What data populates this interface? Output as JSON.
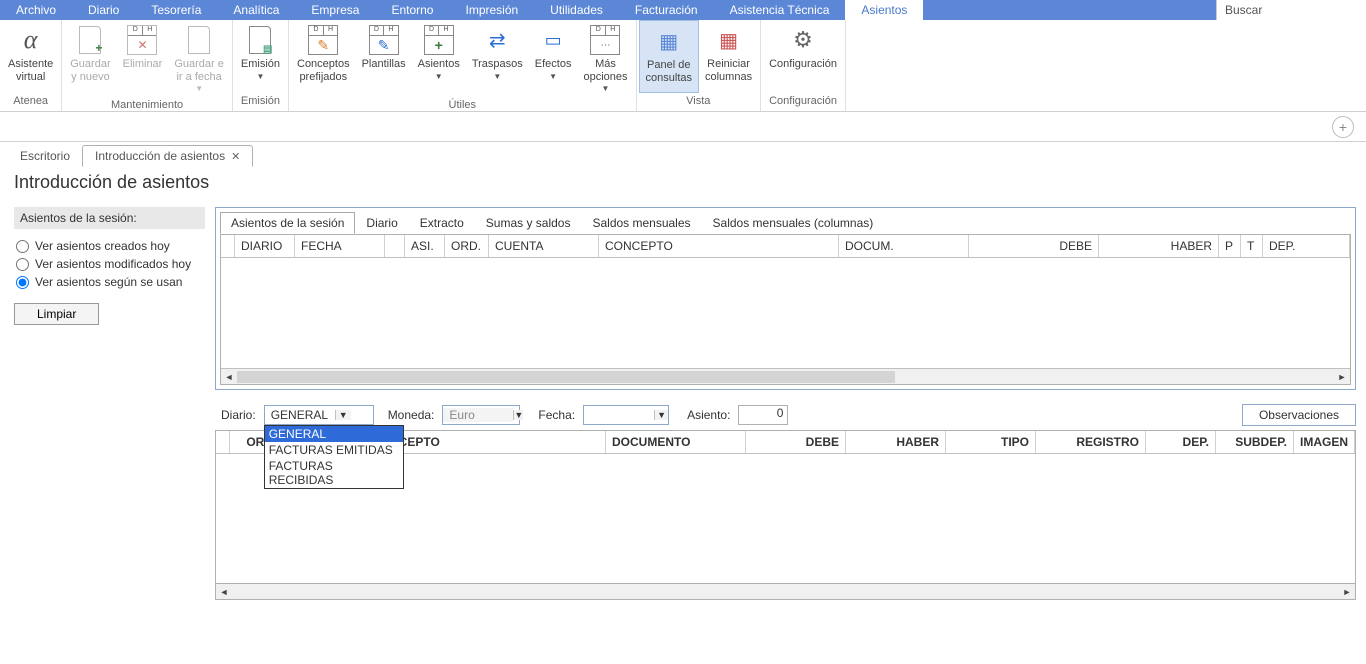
{
  "menu": [
    "Archivo",
    "Diario",
    "Tesorería",
    "Analítica",
    "Empresa",
    "Entorno",
    "Impresión",
    "Utilidades",
    "Facturación",
    "Asistencia Técnica",
    "Asientos"
  ],
  "menu_active_index": 10,
  "search_placeholder": "Buscar",
  "ribbon_groups": [
    {
      "label": "Atenea",
      "buttons": [
        {
          "label": "Asistente\nvirtual",
          "icon": "alpha"
        }
      ]
    },
    {
      "label": "Mantenimiento",
      "buttons": [
        {
          "label": "Guardar\ny nuevo",
          "icon": "doc-plus",
          "disabled": true
        },
        {
          "label": "Eliminar",
          "icon": "dh-x",
          "disabled": true
        },
        {
          "label": "Guardar e\nir a fecha",
          "icon": "doc",
          "disabled": true,
          "drop": true
        }
      ]
    },
    {
      "label": "Emisión",
      "buttons": [
        {
          "label": "Emisión",
          "icon": "doc-print",
          "drop": true
        }
      ]
    },
    {
      "label": "Útiles",
      "buttons": [
        {
          "label": "Conceptos\nprefijados",
          "icon": "dh-pen"
        },
        {
          "label": "Plantillas",
          "icon": "dh-pen"
        },
        {
          "label": "Asientos",
          "icon": "dh-plus",
          "drop": true
        },
        {
          "label": "Traspasos",
          "icon": "arrows",
          "drop": true
        },
        {
          "label": "Efectos",
          "icon": "cards",
          "drop": true
        },
        {
          "label": "Más\nopciones",
          "icon": "dh-dots",
          "drop": true
        }
      ]
    },
    {
      "label": "Vista",
      "buttons": [
        {
          "label": "Panel de\nconsultas",
          "icon": "panel",
          "active": true
        },
        {
          "label": "Reiniciar\ncolumnas",
          "icon": "grid-reset"
        }
      ]
    },
    {
      "label": "Configuración",
      "buttons": [
        {
          "label": "Configuración",
          "icon": "gear"
        }
      ]
    }
  ],
  "doc_tabs": [
    {
      "label": "Escritorio",
      "active": false
    },
    {
      "label": "Introducción de asientos",
      "active": true,
      "closable": true
    }
  ],
  "page_title": "Introducción de asientos",
  "sidebar": {
    "header": "Asientos de la sesión:",
    "radios": [
      {
        "label": "Ver asientos creados hoy",
        "checked": false
      },
      {
        "label": "Ver asientos modificados hoy",
        "checked": false
      },
      {
        "label": "Ver asientos según se usan",
        "checked": true
      }
    ],
    "button": "Limpiar"
  },
  "panel_tabs": [
    "Asientos de la sesión",
    "Diario",
    "Extracto",
    "Sumas y saldos",
    "Saldos mensuales",
    "Saldos mensuales (columnas)"
  ],
  "panel_tabs_active": 0,
  "grid1_columns": [
    "DIARIO",
    "FECHA",
    "",
    "ASI.",
    "ORD.",
    "CUENTA",
    "CONCEPTO",
    "DOCUM.",
    "DEBE",
    "HABER",
    "P",
    "T",
    "DEP."
  ],
  "form": {
    "diario_label": "Diario:",
    "diario_value": "GENERAL",
    "diario_options": [
      "GENERAL",
      "FACTURAS EMITIDAS",
      "FACTURAS RECIBIDAS"
    ],
    "moneda_label": "Moneda:",
    "moneda_value": "Euro",
    "fecha_label": "Fecha:",
    "fecha_value": "",
    "asiento_label": "Asiento:",
    "asiento_value": "0",
    "observaciones": "Observaciones"
  },
  "grid2_columns": [
    "ORD",
    "",
    "NCEPTO",
    "DOCUMENTO",
    "DEBE",
    "HABER",
    "TIPO",
    "REGISTRO",
    "DEP.",
    "SUBDEP.",
    "IMAGEN"
  ]
}
